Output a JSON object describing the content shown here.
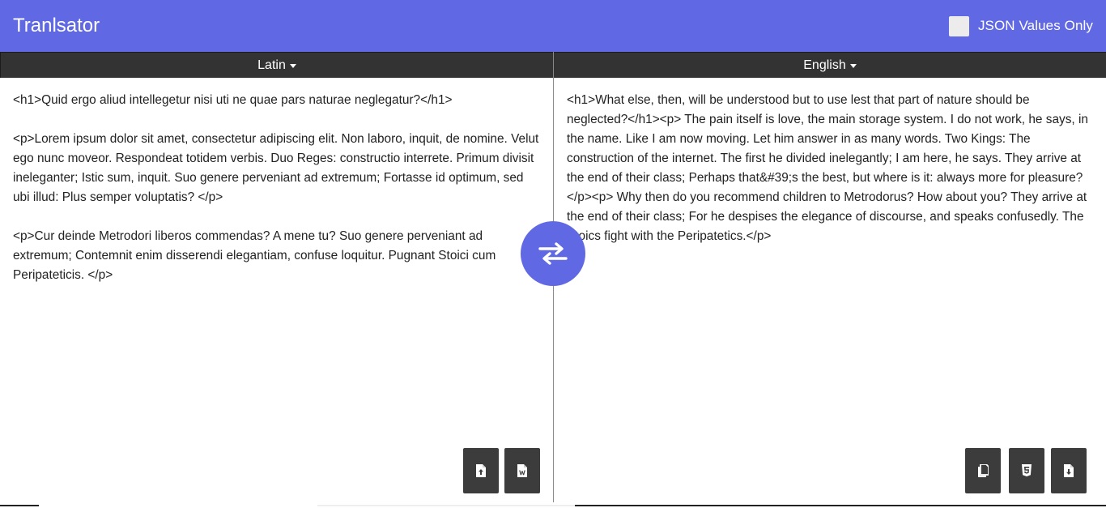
{
  "header": {
    "title": "Tranlsator",
    "json_toggle_label": "JSON Values Only",
    "json_toggle_checked": false,
    "color": "#6069e3"
  },
  "source": {
    "language": "Latin",
    "text": "<h1>Quid ergo aliud intellegetur nisi uti ne quae pars naturae neglegatur?</h1>\n\n<p>Lorem ipsum dolor sit amet, consectetur adipiscing elit. Non laboro, inquit, de nomine. Velut ego nunc moveor. Respondeat totidem verbis. Duo Reges: constructio interrete. Primum divisit ineleganter; Istic sum, inquit. Suo genere perveniant ad extremum; Fortasse id optimum, sed ubi illud: Plus semper voluptatis? </p>\n\n<p>Cur deinde Metrodori liberos commendas? A mene tu? Suo genere perveniant ad extremum; Contemnit enim disserendi elegantiam, confuse loquitur. Pugnant Stoici cum Peripateticis. </p>",
    "buttons": [
      {
        "name": "upload-file-button",
        "icon": "file-upload-icon"
      },
      {
        "name": "upload-word-button",
        "icon": "file-word-icon"
      }
    ]
  },
  "target": {
    "language": "English",
    "text": "<h1>What else, then, will be understood but to use lest that part of nature should be neglected?</h1><p> The pain itself is love, the main storage system. I do not work, he says, in the name. Like I am now moving. Let him answer in as many words. Two Kings: The construction of the internet. The first he divided inelegantly; I am here, he says. They arrive at the end of their class; Perhaps that&#39;s the best, but where is it: always more for pleasure?</p><p> Why then do you recommend children to Metrodorus? How about you? They arrive at the end of their class; For he despises the elegance of discourse, and speaks confusedly. The Stoics fight with the Peripatetics.</p>",
    "buttons": [
      {
        "name": "copy-button",
        "icon": "copy-icon"
      },
      {
        "name": "html5-button",
        "icon": "html5-icon"
      },
      {
        "name": "download-button",
        "icon": "file-download-icon"
      }
    ]
  },
  "swap": {
    "icon": "swap-arrows-icon"
  }
}
